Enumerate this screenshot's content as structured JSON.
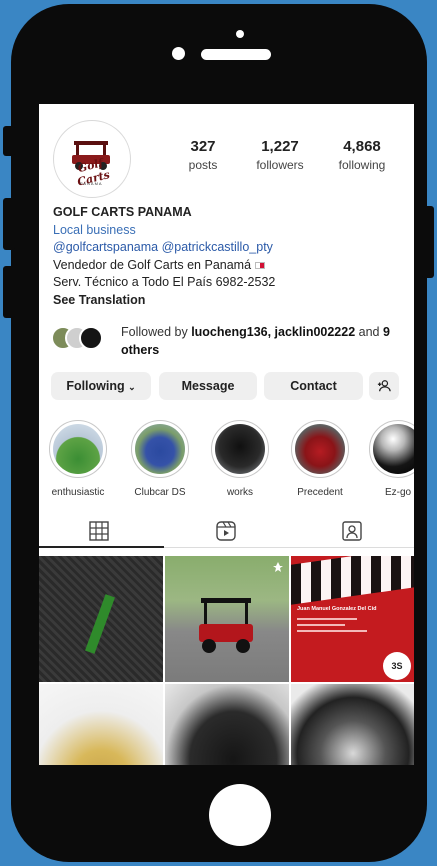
{
  "profile": {
    "logo_text": "Golf Carts",
    "logo_sub": "PANAMA",
    "posts_count": "327",
    "posts_label": "posts",
    "followers_count": "1,227",
    "followers_label": "followers",
    "following_count": "4,868",
    "following_label": "following",
    "name": "GOLF CARTS PANAMA",
    "category": "Local business",
    "tags": "@golfcartspanama @patrickcastillo_pty",
    "bio_line1": "Vendedor de Golf Carts en Panamá",
    "bio_line2": "Serv. Técnico a Todo El País 6982-2532",
    "see_translation": "See Translation"
  },
  "followed_by": {
    "prefix": "Followed by",
    "users": "luocheng136, jacklin002222",
    "and": "and",
    "others": "9 others"
  },
  "actions": {
    "following": "Following",
    "message": "Message",
    "contact": "Contact",
    "add_user": "+♂"
  },
  "highlights": [
    {
      "label": "enthusiastic"
    },
    {
      "label": "Clubcar DS"
    },
    {
      "label": "works"
    },
    {
      "label": "Precedent"
    },
    {
      "label": "Ez-go"
    }
  ],
  "tabs": [
    "grid-icon",
    "reels-icon",
    "tagged-icon"
  ],
  "card": {
    "name": "Juan Manuel Gonzalez Del Cid",
    "logo": "3S"
  },
  "colors": {
    "background": "#3a86c4",
    "phone": "#0b0b0b",
    "link": "#2b5aa8",
    "button": "#efefef"
  }
}
